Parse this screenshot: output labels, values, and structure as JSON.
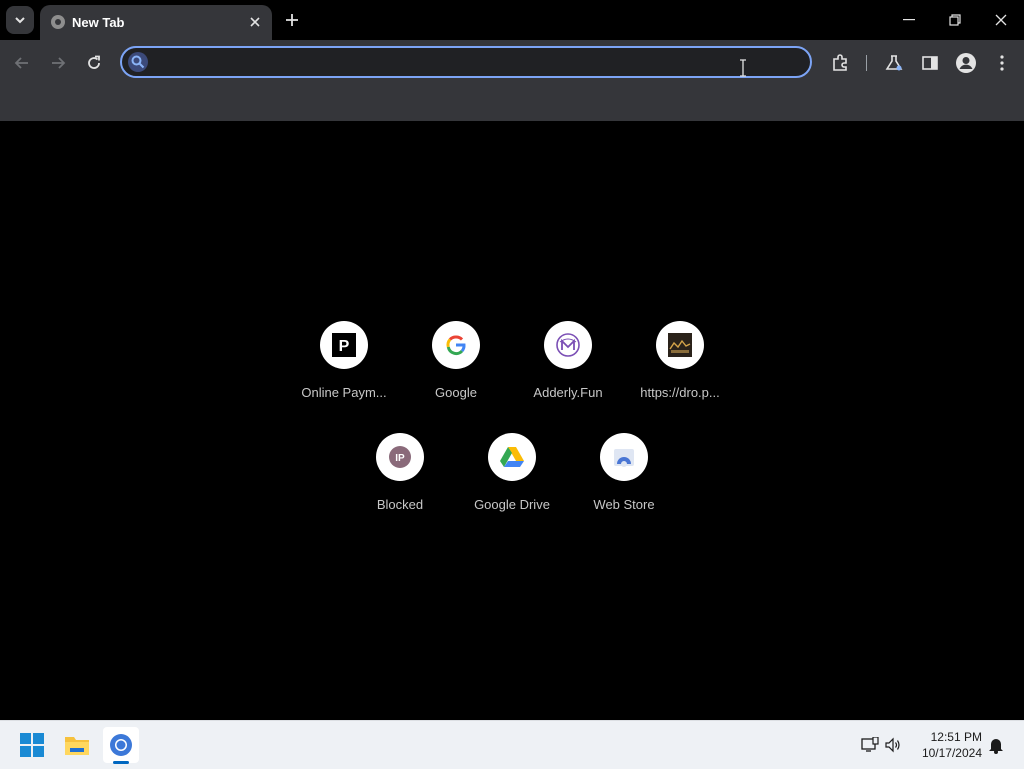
{
  "window": {
    "tab_title": "New Tab"
  },
  "omnibox": {
    "value": "",
    "placeholder": ""
  },
  "shortcuts": [
    {
      "label": "Online Paym...",
      "icon": "p-logo-icon"
    },
    {
      "label": "Google",
      "icon": "google-logo-icon"
    },
    {
      "label": "Adderly.Fun",
      "icon": "adderly-logo-icon"
    },
    {
      "label": "https://dro.p...",
      "icon": "site-thumbnail-icon"
    },
    {
      "label": "Blocked",
      "icon": "ip-badge-icon"
    },
    {
      "label": "Google Drive",
      "icon": "google-drive-icon"
    },
    {
      "label": "Web Store",
      "icon": "web-store-icon"
    }
  ],
  "taskbar": {
    "time": "12:51 PM",
    "date": "10/17/2024"
  },
  "colors": {
    "accent": "#7ca4f5",
    "toolbar": "#35363a",
    "page_bg": "#000000"
  }
}
